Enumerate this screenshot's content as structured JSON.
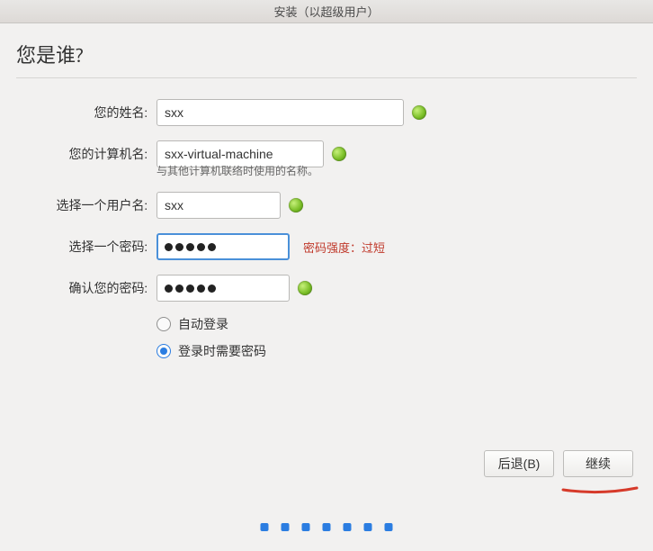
{
  "window": {
    "title": "安装（以超级用户）"
  },
  "page": {
    "title": "您是谁?"
  },
  "form": {
    "name": {
      "label": "您的姓名:",
      "value": "sxx"
    },
    "hostname": {
      "label": "您的计算机名:",
      "value": "sxx-virtual-machine",
      "hint": "与其他计算机联络时使用的名称。"
    },
    "username": {
      "label": "选择一个用户名:",
      "value": "sxx"
    },
    "password": {
      "label": "选择一个密码:",
      "value": "●●●●●",
      "strength": "密码强度：过短"
    },
    "confirm": {
      "label": "确认您的密码:",
      "value": "●●●●●"
    },
    "radio": {
      "auto": "自动登录",
      "require_pw": "登录时需要密码",
      "selected": "require_pw"
    }
  },
  "buttons": {
    "back": "后退(B)",
    "continue": "继续"
  },
  "colors": {
    "accent": "#2b7de1",
    "error": "#c0392b",
    "ok": "#7bbf28"
  },
  "progress": {
    "total_dots": 7
  }
}
